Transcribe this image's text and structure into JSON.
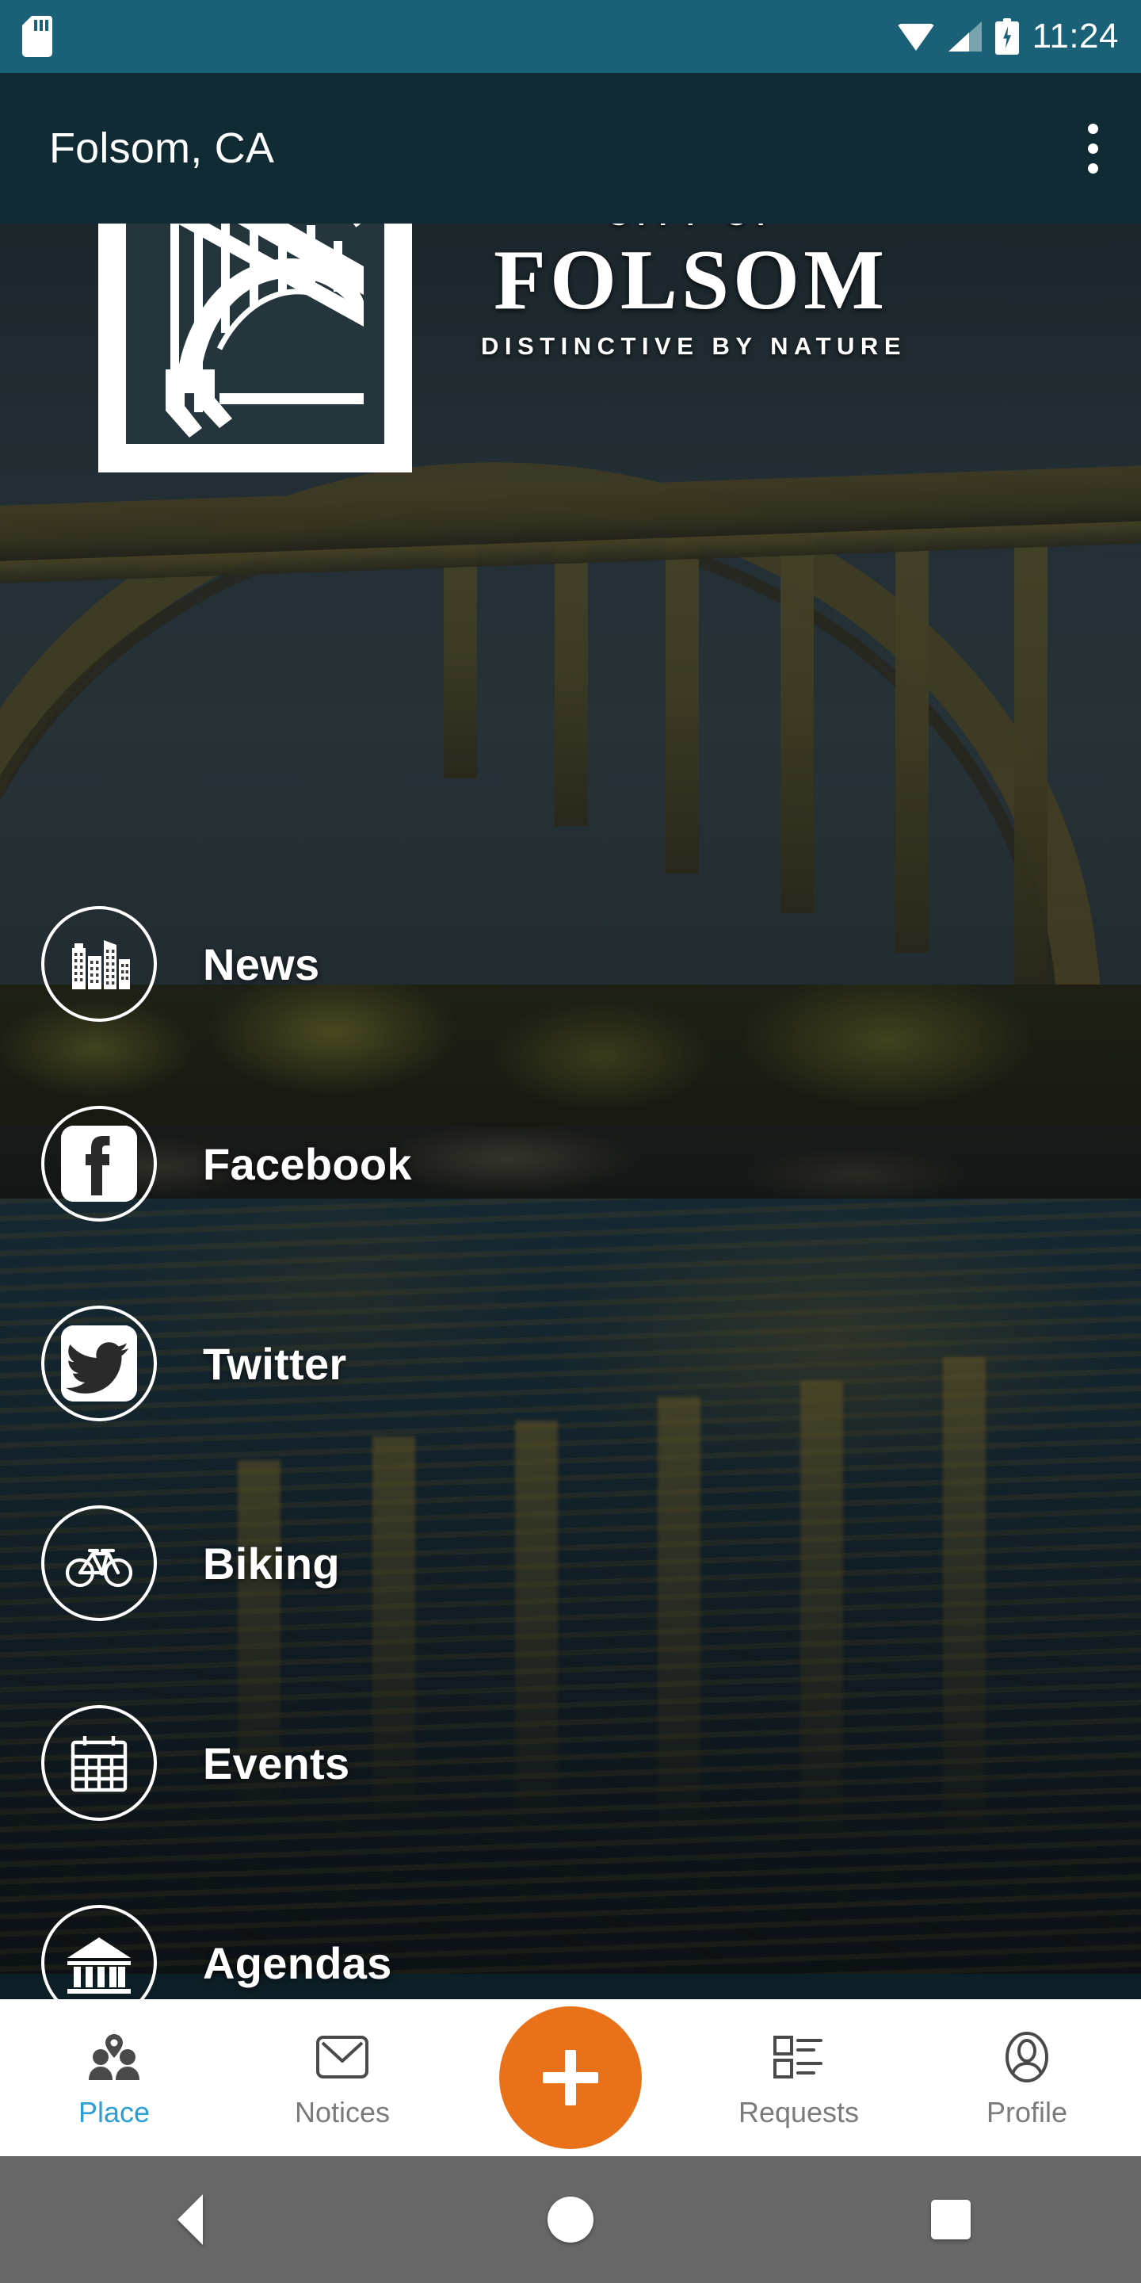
{
  "status_bar": {
    "time": "11:24",
    "icons": [
      "sd-card-icon",
      "wifi-icon",
      "cellular-signal-icon",
      "battery-charging-icon"
    ],
    "background_color": "#1a6178"
  },
  "app_bar": {
    "title": "Folsom, CA",
    "overflow_icon": "more-vert-icon",
    "background_color": "#102b33"
  },
  "hero": {
    "crest_icon": "folsom-bridge-crest-icon",
    "wordmark": {
      "line1": "CITY OF",
      "line2": "FOLSOM",
      "line3": "DISTINCTIVE BY NATURE"
    }
  },
  "menu": {
    "items": [
      {
        "label": "News",
        "icon": "city-buildings-icon"
      },
      {
        "label": "Facebook",
        "icon": "facebook-icon"
      },
      {
        "label": "Twitter",
        "icon": "twitter-bird-icon"
      },
      {
        "label": "Biking",
        "icon": "bicycle-icon"
      },
      {
        "label": "Events",
        "icon": "calendar-icon"
      },
      {
        "label": "Agendas",
        "icon": "government-building-icon"
      }
    ]
  },
  "bottom_nav": {
    "active_color": "#2b9fd4",
    "inactive_color": "#7b7b7b",
    "fab": {
      "icon": "plus-icon",
      "color": "#e8711a"
    },
    "items": [
      {
        "label": "Place",
        "icon": "people-location-icon",
        "active": true
      },
      {
        "label": "Notices",
        "icon": "envelope-icon",
        "active": false
      },
      {
        "label": "Requests",
        "icon": "checklist-icon",
        "active": false
      },
      {
        "label": "Profile",
        "icon": "person-oval-icon",
        "active": false
      }
    ]
  },
  "android_nav": {
    "back": "back-triangle-icon",
    "home": "home-circle-icon",
    "recents": "recents-square-icon",
    "background_color": "#676767"
  }
}
